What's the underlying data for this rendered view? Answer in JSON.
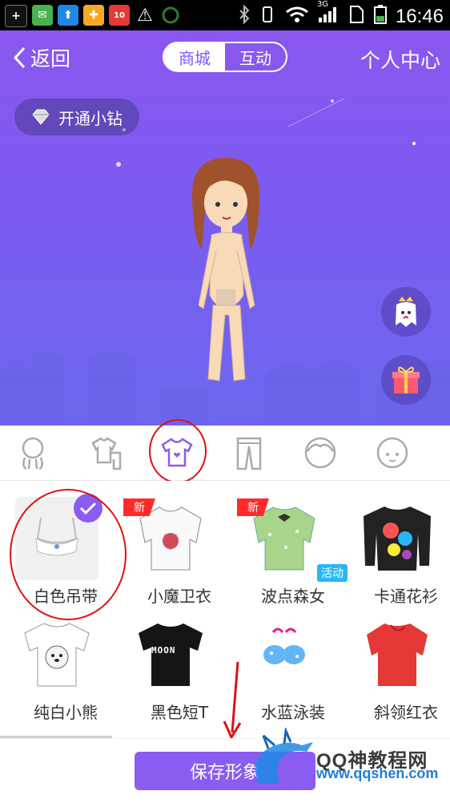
{
  "status_bar": {
    "time": "16:46",
    "network": "3G",
    "notification_icons": [
      "plus-icon",
      "mail-icon",
      "upload-icon",
      "game-icon",
      "app-badge-icon",
      "warning-icon",
      "ring-icon"
    ],
    "app_badge_count": "10"
  },
  "nav": {
    "back_label": "返回",
    "tabs": [
      {
        "label": "商城",
        "active": true
      },
      {
        "label": "互动",
        "active": false
      }
    ],
    "user_center_label": "个人中心"
  },
  "vip_button": {
    "label": "开通小钻"
  },
  "category_tabs": [
    {
      "name": "figure",
      "icon": "figure-icon",
      "selected": false
    },
    {
      "name": "outfit",
      "icon": "outfit-icon",
      "selected": false
    },
    {
      "name": "tops",
      "icon": "tshirt-heart-icon",
      "selected": true
    },
    {
      "name": "pants",
      "icon": "pants-icon",
      "selected": false
    },
    {
      "name": "hair",
      "icon": "hair-icon",
      "selected": false
    },
    {
      "name": "face",
      "icon": "face-icon",
      "selected": false
    }
  ],
  "items": [
    {
      "label": "白色吊带",
      "badge": "",
      "selected": true
    },
    {
      "label": "小魔卫衣",
      "badge": "新"
    },
    {
      "label": "波点森女",
      "badge": "新",
      "tag": "活动"
    },
    {
      "label": "卡通花衫",
      "badge": ""
    },
    {
      "label": "纯白小熊",
      "badge": ""
    },
    {
      "label": "黑色短T",
      "badge": ""
    },
    {
      "label": "水蓝泳装",
      "badge": ""
    },
    {
      "label": "斜领红衣",
      "badge": ""
    }
  ],
  "tshirt_print": "MOON",
  "save_button_label": "保存形象",
  "watermark": {
    "line1": "QQ神教程网",
    "line2": "www.qqshen.com"
  },
  "colors": {
    "accent": "#8a5cf0",
    "badge_new": "#ff2b2b",
    "badge_activity": "#29b6f6",
    "annotation": "#e01010"
  }
}
